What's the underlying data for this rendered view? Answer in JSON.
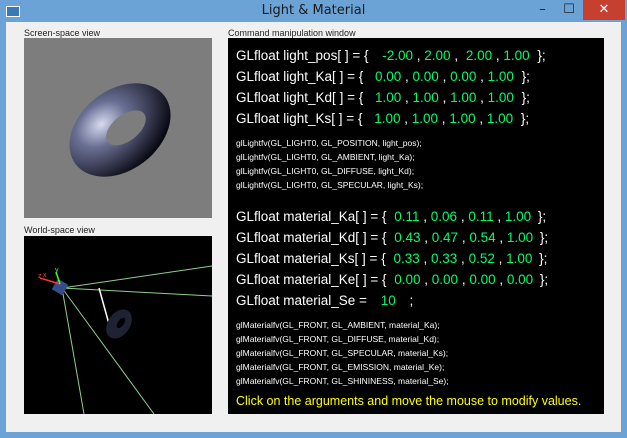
{
  "window": {
    "title": "Light & Material",
    "minimize": "–",
    "maximize": "☐",
    "close": "✕"
  },
  "labels": {
    "screen": "Screen-space view",
    "world": "World-space view",
    "command": "Command manipulation window"
  },
  "light": {
    "pos": {
      "prefix": "GLfloat light_pos[ ] = {",
      "values": [
        "-2.00",
        "2.00",
        "2.00",
        "1.00"
      ],
      "suffix": "};"
    },
    "ka": {
      "prefix": "GLfloat light_Ka[ ] = {",
      "values": [
        "0.00",
        "0.00",
        "0.00",
        "1.00"
      ],
      "suffix": "};"
    },
    "kd": {
      "prefix": "GLfloat light_Kd[ ] = {",
      "values": [
        "1.00",
        "1.00",
        "1.00",
        "1.00"
      ],
      "suffix": "};"
    },
    "ks": {
      "prefix": "GLfloat light_Ks[ ] = {",
      "values": [
        "1.00",
        "1.00",
        "1.00",
        "1.00"
      ],
      "suffix": "};"
    }
  },
  "light_calls": [
    "glLightfv(GL_LIGHT0, GL_POSITION, light_pos);",
    "glLightfv(GL_LIGHT0, GL_AMBIENT, light_Ka);",
    "glLightfv(GL_LIGHT0, GL_DIFFUSE, light_Kd);",
    "glLightfv(GL_LIGHT0, GL_SPECULAR, light_Ks);"
  ],
  "material": {
    "ka": {
      "prefix": "GLfloat material_Ka[ ] = {",
      "values": [
        "0.11",
        "0.06",
        "0.11",
        "1.00"
      ],
      "suffix": "};"
    },
    "kd": {
      "prefix": "GLfloat material_Kd[ ] = {",
      "values": [
        "0.43",
        "0.47",
        "0.54",
        "1.00"
      ],
      "suffix": "};"
    },
    "ks": {
      "prefix": "GLfloat material_Ks[ ] = {",
      "values": [
        "0.33",
        "0.33",
        "0.52",
        "1.00"
      ],
      "suffix": "};"
    },
    "ke": {
      "prefix": "GLfloat material_Ke[ ] = {",
      "values": [
        "0.00",
        "0.00",
        "0.00",
        "0.00"
      ],
      "suffix": "};"
    },
    "se": {
      "prefix": "GLfloat material_Se =",
      "value": "10",
      "suffix": ";"
    }
  },
  "material_calls": [
    "glMaterialfv(GL_FRONT, GL_AMBIENT, material_Ka);",
    "glMaterialfv(GL_FRONT, GL_DIFFUSE, material_Kd);",
    "glMaterialfv(GL_FRONT, GL_SPECULAR, material_Ks);",
    "glMaterialfv(GL_FRONT, GL_EMISSION, material_Ke);",
    "glMaterialfv(GL_FRONT, GL_SHININESS, material_Se);"
  ],
  "hint": "Click on the arguments and move the mouse to modify values.",
  "colors": {
    "value": "#00ff66",
    "text": "#ffffff",
    "hint": "#ffff00",
    "close_button": "#c7402f"
  }
}
